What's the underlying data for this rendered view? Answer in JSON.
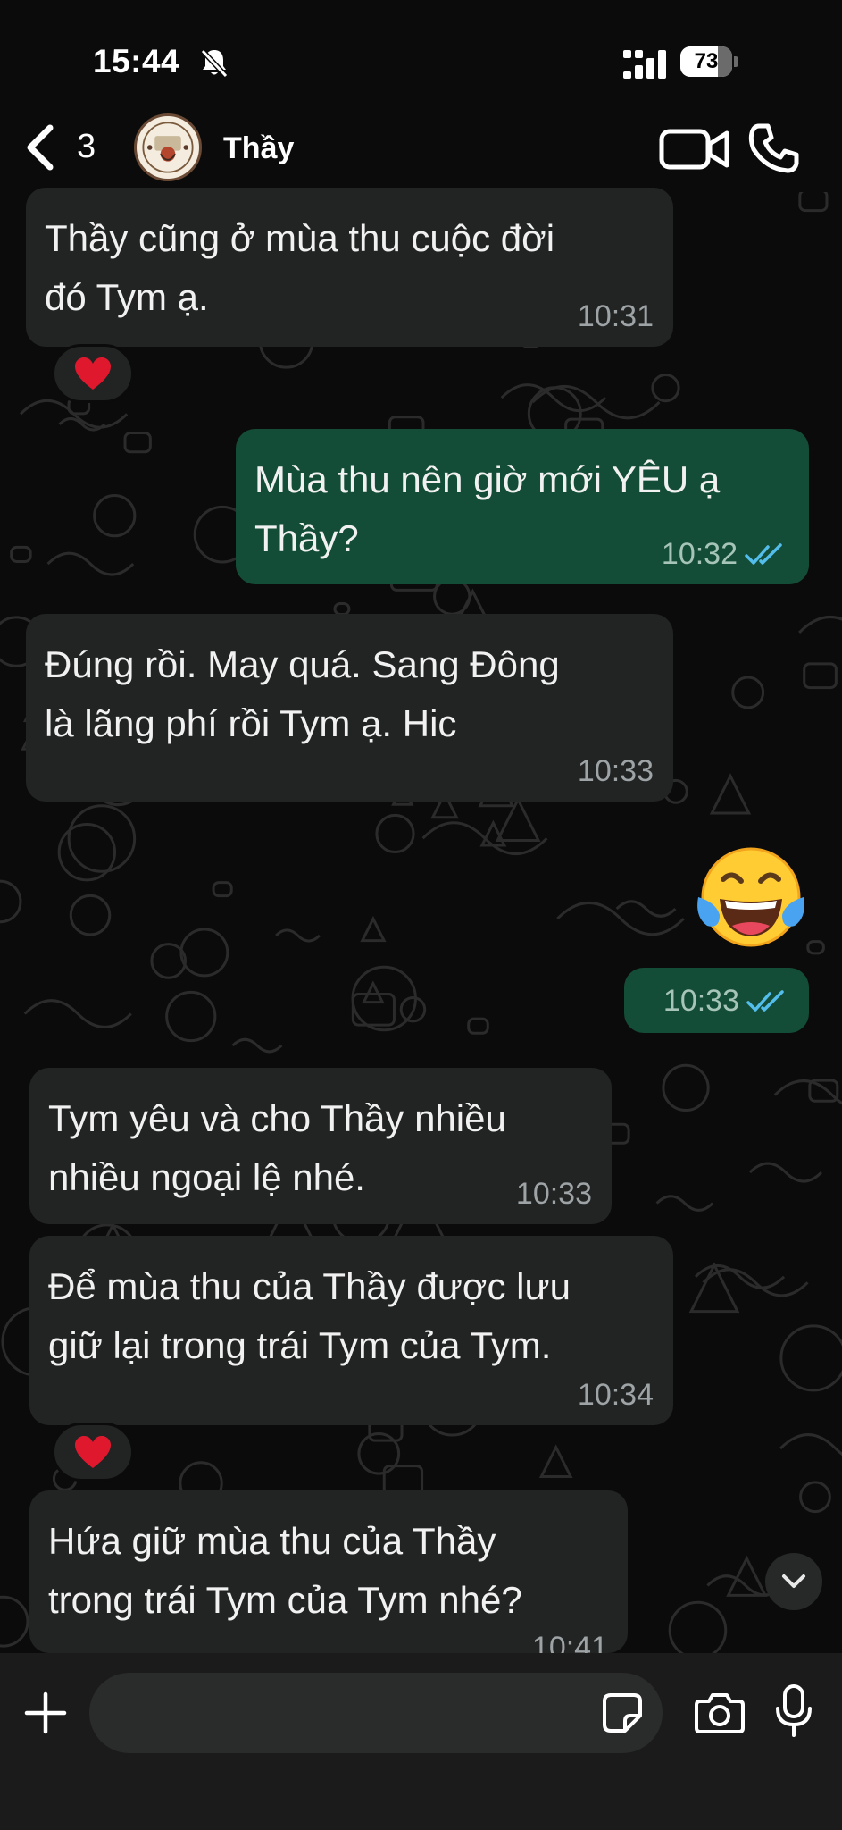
{
  "status_bar": {
    "time": "15:44",
    "battery_level": "73"
  },
  "header": {
    "unread_count": "3",
    "contact_name": "Thầy"
  },
  "messages": [
    {
      "direction": "in",
      "text_lines": [
        "Thầy cũng ở mùa thu cuộc đời",
        "đó Tym ạ."
      ],
      "time": "10:31",
      "reaction": "heart"
    },
    {
      "direction": "out",
      "text_lines": [
        "Mùa thu nên giờ mới YÊU ạ",
        "Thầy?"
      ],
      "time": "10:32",
      "status": "read"
    },
    {
      "direction": "in",
      "text_lines": [
        "Đúng rồi. May quá. Sang Đông",
        "là lãng phí rồi Tym ạ. Hic"
      ],
      "time": "10:33"
    },
    {
      "direction": "out",
      "emoji": "face-with-tears-of-joy",
      "time": "10:33",
      "status": "read"
    },
    {
      "direction": "in",
      "text_lines": [
        "Tym yêu và cho Thầy nhiều",
        "nhiều ngoại lệ nhé."
      ],
      "time": "10:33"
    },
    {
      "direction": "in",
      "text_lines": [
        "Để mùa thu của Thầy được lưu",
        "giữ lại trong trái Tym của Tym."
      ],
      "time": "10:34",
      "reaction": "heart"
    },
    {
      "direction": "in",
      "text_lines": [
        "Hứa giữ mùa thu của Thầy",
        "trong trái Tym của Tym nhé?"
      ],
      "time": "10:41"
    }
  ],
  "composer": {
    "placeholder": ""
  },
  "colors": {
    "incoming_bubble": "#222323",
    "outgoing_bubble": "#144d37",
    "read_ticks": "#53bdeb",
    "background": "#0b0b0b"
  }
}
